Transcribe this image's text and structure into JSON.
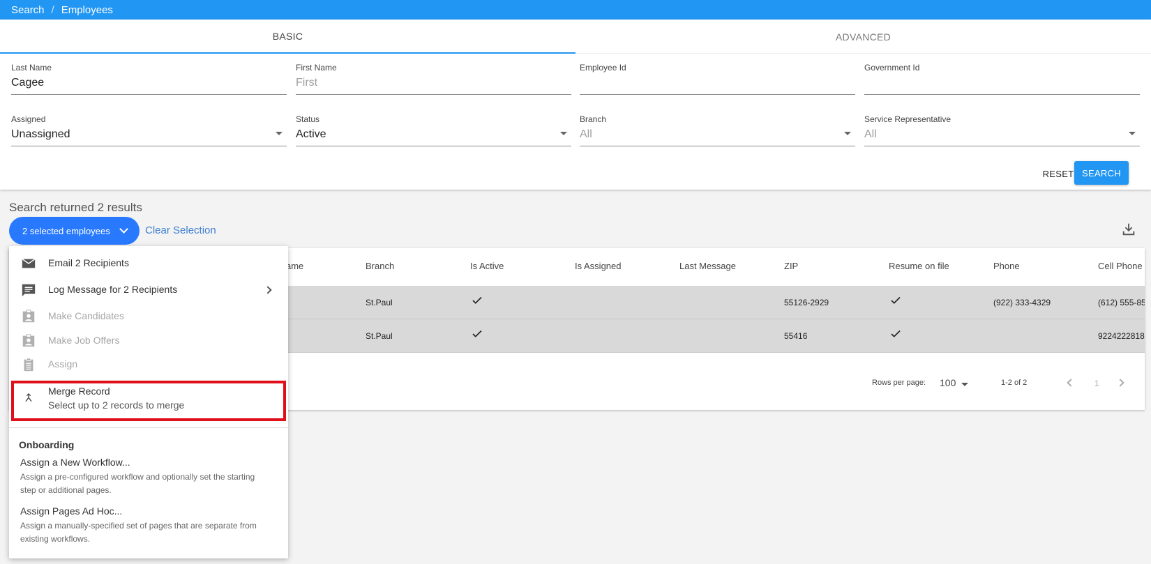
{
  "breadcrumb": {
    "items": [
      "Search",
      "Employees"
    ],
    "separator": "/"
  },
  "tabs": [
    {
      "label": "BASIC",
      "active": true
    },
    {
      "label": "ADVANCED",
      "active": false
    }
  ],
  "form": {
    "last_name": {
      "label": "Last Name",
      "value": "Cagee"
    },
    "first_name": {
      "label": "First Name",
      "placeholder": "First"
    },
    "employee_id": {
      "label": "Employee Id",
      "value": ""
    },
    "government_id": {
      "label": "Government Id",
      "value": ""
    },
    "assigned": {
      "label": "Assigned",
      "value": "Unassigned"
    },
    "status": {
      "label": "Status",
      "value": "Active"
    },
    "branch": {
      "label": "Branch",
      "value": "All"
    },
    "service_rep": {
      "label": "Service Representative",
      "value": "All"
    },
    "reset_label": "RESET",
    "search_label": "SEARCH"
  },
  "results": {
    "count_text": "Search returned 2 results",
    "selection_label": "2 selected employees",
    "clear_label": "Clear Selection"
  },
  "table": {
    "columns": [
      "ame",
      "Branch",
      "Is Active",
      "Is Assigned",
      "Last Message",
      "ZIP",
      "Resume on file",
      "Phone",
      "Cell Phone"
    ],
    "rows": [
      {
        "branch": "St.Paul",
        "is_active": true,
        "zip": "55126-2929",
        "resume": true,
        "phone": "(922) 333-4329",
        "cell": "(612) 555-85"
      },
      {
        "branch": "St.Paul",
        "is_active": true,
        "zip": "55416",
        "resume": true,
        "phone": "",
        "cell": "9224222818"
      }
    ],
    "rows_per_page_label": "Rows per page:",
    "rows_per_page": "100",
    "range": "1-2 of 2",
    "page": "1"
  },
  "menu": {
    "items": [
      {
        "label": "Email 2 Recipients",
        "icon": "email-icon",
        "enabled": true
      },
      {
        "label": "Log Message for 2 Recipients",
        "icon": "message-icon",
        "enabled": true,
        "submenu": true
      },
      {
        "label": "Make Candidates",
        "icon": "badge-icon",
        "enabled": false
      },
      {
        "label": "Make Job Offers",
        "icon": "badge-icon",
        "enabled": false
      },
      {
        "label": "Assign",
        "icon": "clipboard-icon",
        "enabled": false
      }
    ],
    "merge": {
      "title": "Merge Record",
      "subtitle": "Select up to 2 records to merge",
      "icon": "merge-icon"
    },
    "onboarding": {
      "title": "Onboarding",
      "workflows": [
        {
          "title": "Assign a New Workflow...",
          "desc": "Assign a pre-configured workflow and optionally set the starting step or additional pages."
        },
        {
          "title": "Assign Pages Ad Hoc...",
          "desc": "Assign a manually-specified set of pages that are separate from existing workflows."
        }
      ]
    }
  },
  "colors": {
    "primary": "#2196f3",
    "chip": "#2979ff",
    "highlight": "#e0101b",
    "row": "#d9d9d9"
  }
}
